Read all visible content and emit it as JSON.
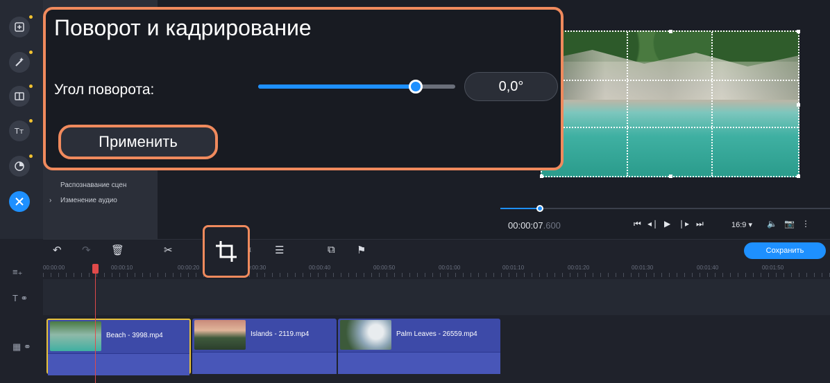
{
  "sidebar": {
    "tools": [
      {
        "icon": "import-icon"
      },
      {
        "icon": "magic-wand-icon"
      },
      {
        "icon": "transitions-icon"
      },
      {
        "icon": "titles-icon"
      },
      {
        "icon": "stickers-icon"
      },
      {
        "icon": "more-tools-icon"
      }
    ],
    "panel_items": [
      "Распознавание сцен",
      "Изменение аудио"
    ]
  },
  "popup": {
    "title": "Поворот и кадрирование",
    "angle_label": "Угол поворота:",
    "angle_value": "0,0°",
    "slider_position": 0.8,
    "apply_label": "Применить"
  },
  "player": {
    "time_main": "00:00:07",
    "time_ms": ".600",
    "aspect_ratio": "16:9 ▾",
    "scrub_progress": 0.12
  },
  "toolbar": {
    "save_label": "Сохранить"
  },
  "ruler": {
    "ticks": [
      "00:00:00",
      "00:00:10",
      "00:00:20",
      "00:00:30",
      "00:00:40",
      "00:00:50",
      "00:01:00",
      "00:01:10",
      "00:01:20",
      "00:01:30",
      "00:01:40",
      "00:01:50"
    ]
  },
  "timeline": {
    "clips": [
      {
        "name": "Beach - 3998.mp4",
        "selected": true
      },
      {
        "name": "Islands - 2119.mp4",
        "selected": false
      },
      {
        "name": "Palm Leaves - 26559.mp4",
        "selected": false
      }
    ]
  },
  "colors": {
    "accent": "#1e90ff",
    "highlight": "#f08a5d",
    "clip": "#3d4aa8",
    "playhead": "#e04a4a"
  }
}
